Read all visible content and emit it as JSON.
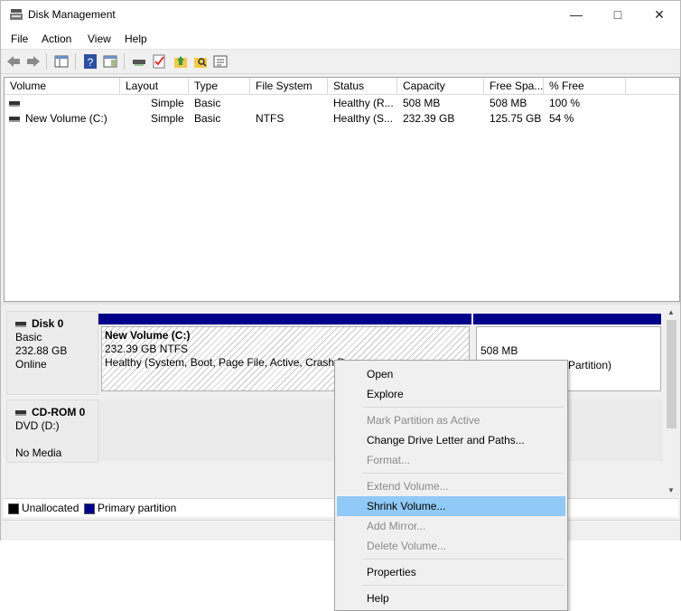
{
  "window": {
    "title": "Disk Management"
  },
  "menubar": [
    "File",
    "Action",
    "View",
    "Help"
  ],
  "volume_list": {
    "columns": [
      "Volume",
      "Layout",
      "Type",
      "File System",
      "Status",
      "Capacity",
      "Free Spa...",
      "% Free"
    ],
    "rows": [
      {
        "volume": "",
        "layout": "Simple",
        "type": "Basic",
        "file_system": "",
        "status": "Healthy (R...",
        "capacity": "508 MB",
        "free_space": "508 MB",
        "pct_free": "100 %"
      },
      {
        "volume": "New Volume (C:)",
        "layout": "Simple",
        "type": "Basic",
        "file_system": "NTFS",
        "status": "Healthy (S...",
        "capacity": "232.39 GB",
        "free_space": "125.75 GB",
        "pct_free": "54 %"
      }
    ]
  },
  "disk_map": {
    "disks": [
      {
        "name": "Disk 0",
        "type": "Basic",
        "size": "232.88 GB",
        "state": "Online",
        "partitions": [
          {
            "name": "New Volume  (C:)",
            "detail": "232.39 GB NTFS",
            "status": "Healthy (System, Boot, Page File, Active, Crash D"
          },
          {
            "size": "508 MB",
            "status": "Partition)"
          }
        ]
      },
      {
        "name": "CD-ROM 0",
        "type": "DVD (D:)",
        "state": "No Media"
      }
    ],
    "legend": [
      {
        "label": "Unallocated",
        "color": "#000000"
      },
      {
        "label": "Primary partition",
        "color": "#00008b"
      }
    ]
  },
  "context_menu": {
    "items": [
      {
        "label": "Open",
        "enabled": true
      },
      {
        "label": "Explore",
        "enabled": true
      },
      {
        "label": "Mark Partition as Active",
        "enabled": false
      },
      {
        "label": "Change Drive Letter and Paths...",
        "enabled": true
      },
      {
        "label": "Format...",
        "enabled": false
      },
      {
        "label": "Extend Volume...",
        "enabled": false
      },
      {
        "label": "Shrink Volume...",
        "enabled": true,
        "highlighted": true
      },
      {
        "label": "Add Mirror...",
        "enabled": false
      },
      {
        "label": "Delete Volume...",
        "enabled": false
      },
      {
        "label": "Properties",
        "enabled": true
      },
      {
        "label": "Help",
        "enabled": true
      }
    ]
  },
  "colors": {
    "primary_partition": "#00008b",
    "highlight": "#91c9f7"
  }
}
